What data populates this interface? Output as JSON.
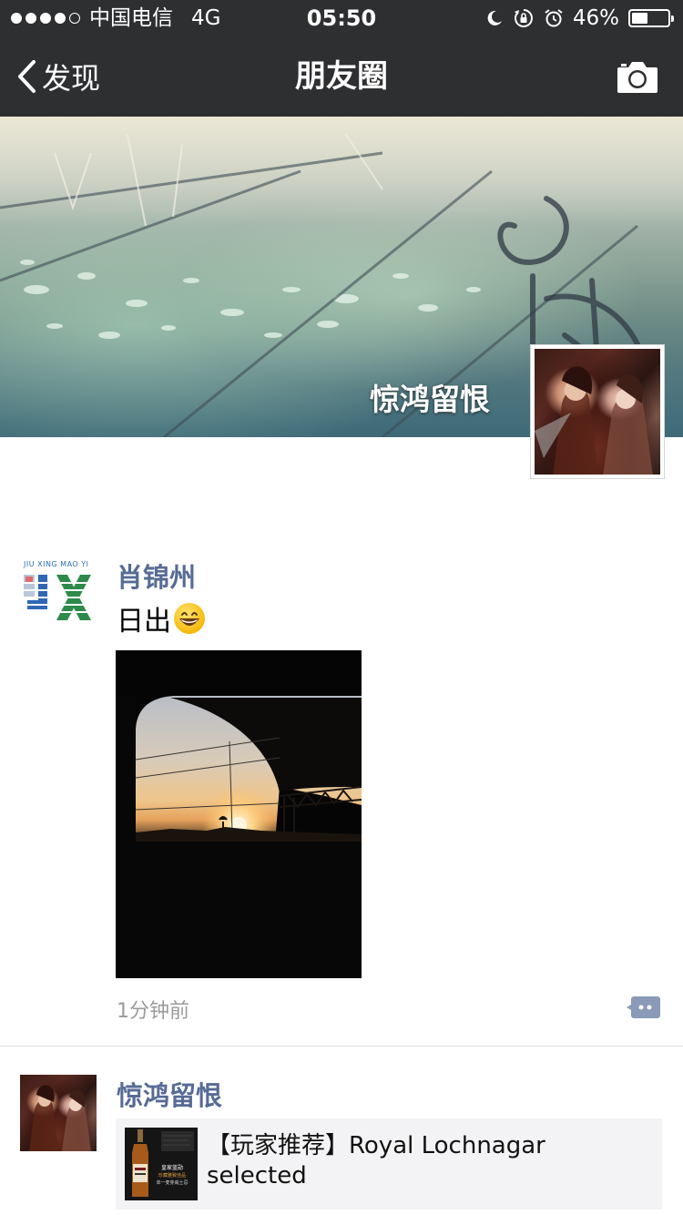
{
  "status_bar": {
    "carrier": "中国电信",
    "network": "4G",
    "time": "05:50",
    "battery_percent": "46%",
    "battery_level": 0.46
  },
  "nav": {
    "back_label": "发现",
    "title": "朋友圈"
  },
  "cover": {
    "username": "惊鸿留恨"
  },
  "posts": [
    {
      "author": "肖锦州",
      "text": "日出",
      "time": "1分钟前"
    },
    {
      "author": "惊鸿留恨",
      "share_title": "【玩家推荐】Royal Lochnagar selected"
    }
  ],
  "logo_text": {
    "top": "JIU XING MAO YI",
    "letters": "JX"
  },
  "thumb_text": {
    "line1": "皇家蓝勋",
    "line2": "珍藏雅致佳品",
    "line3": "单一麦芽威士忌"
  },
  "colors": {
    "nav_bg": "#2e2f31",
    "name_blue": "#576b95",
    "time_gray": "#9b9b9b",
    "card_bg": "#f3f3f5"
  },
  "icons": {
    "back": "chevron-left-icon",
    "camera": "camera-icon",
    "comment": "comment-icon",
    "emoji": "grinning-face-icon"
  }
}
